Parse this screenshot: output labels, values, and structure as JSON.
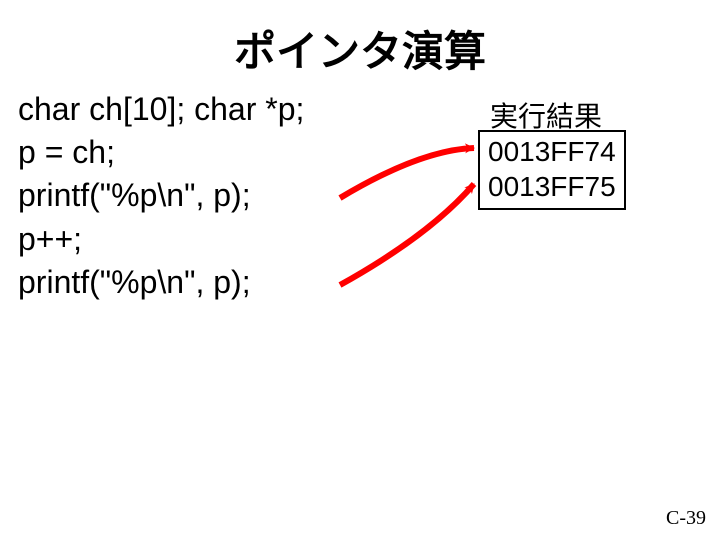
{
  "title": "ポインタ演算",
  "code": {
    "line1": "char ch[10]; char *p;",
    "line2": "p = ch;",
    "line3": "printf(\"%p\\n\", p);",
    "line4": "p++;",
    "line5": "printf(\"%p\\n\", p);"
  },
  "result": {
    "label": "実行結果",
    "line1": "0013FF74",
    "line2": "0013FF75"
  },
  "pagenum": "C-39",
  "colors": {
    "arrow": "#ff0000"
  }
}
